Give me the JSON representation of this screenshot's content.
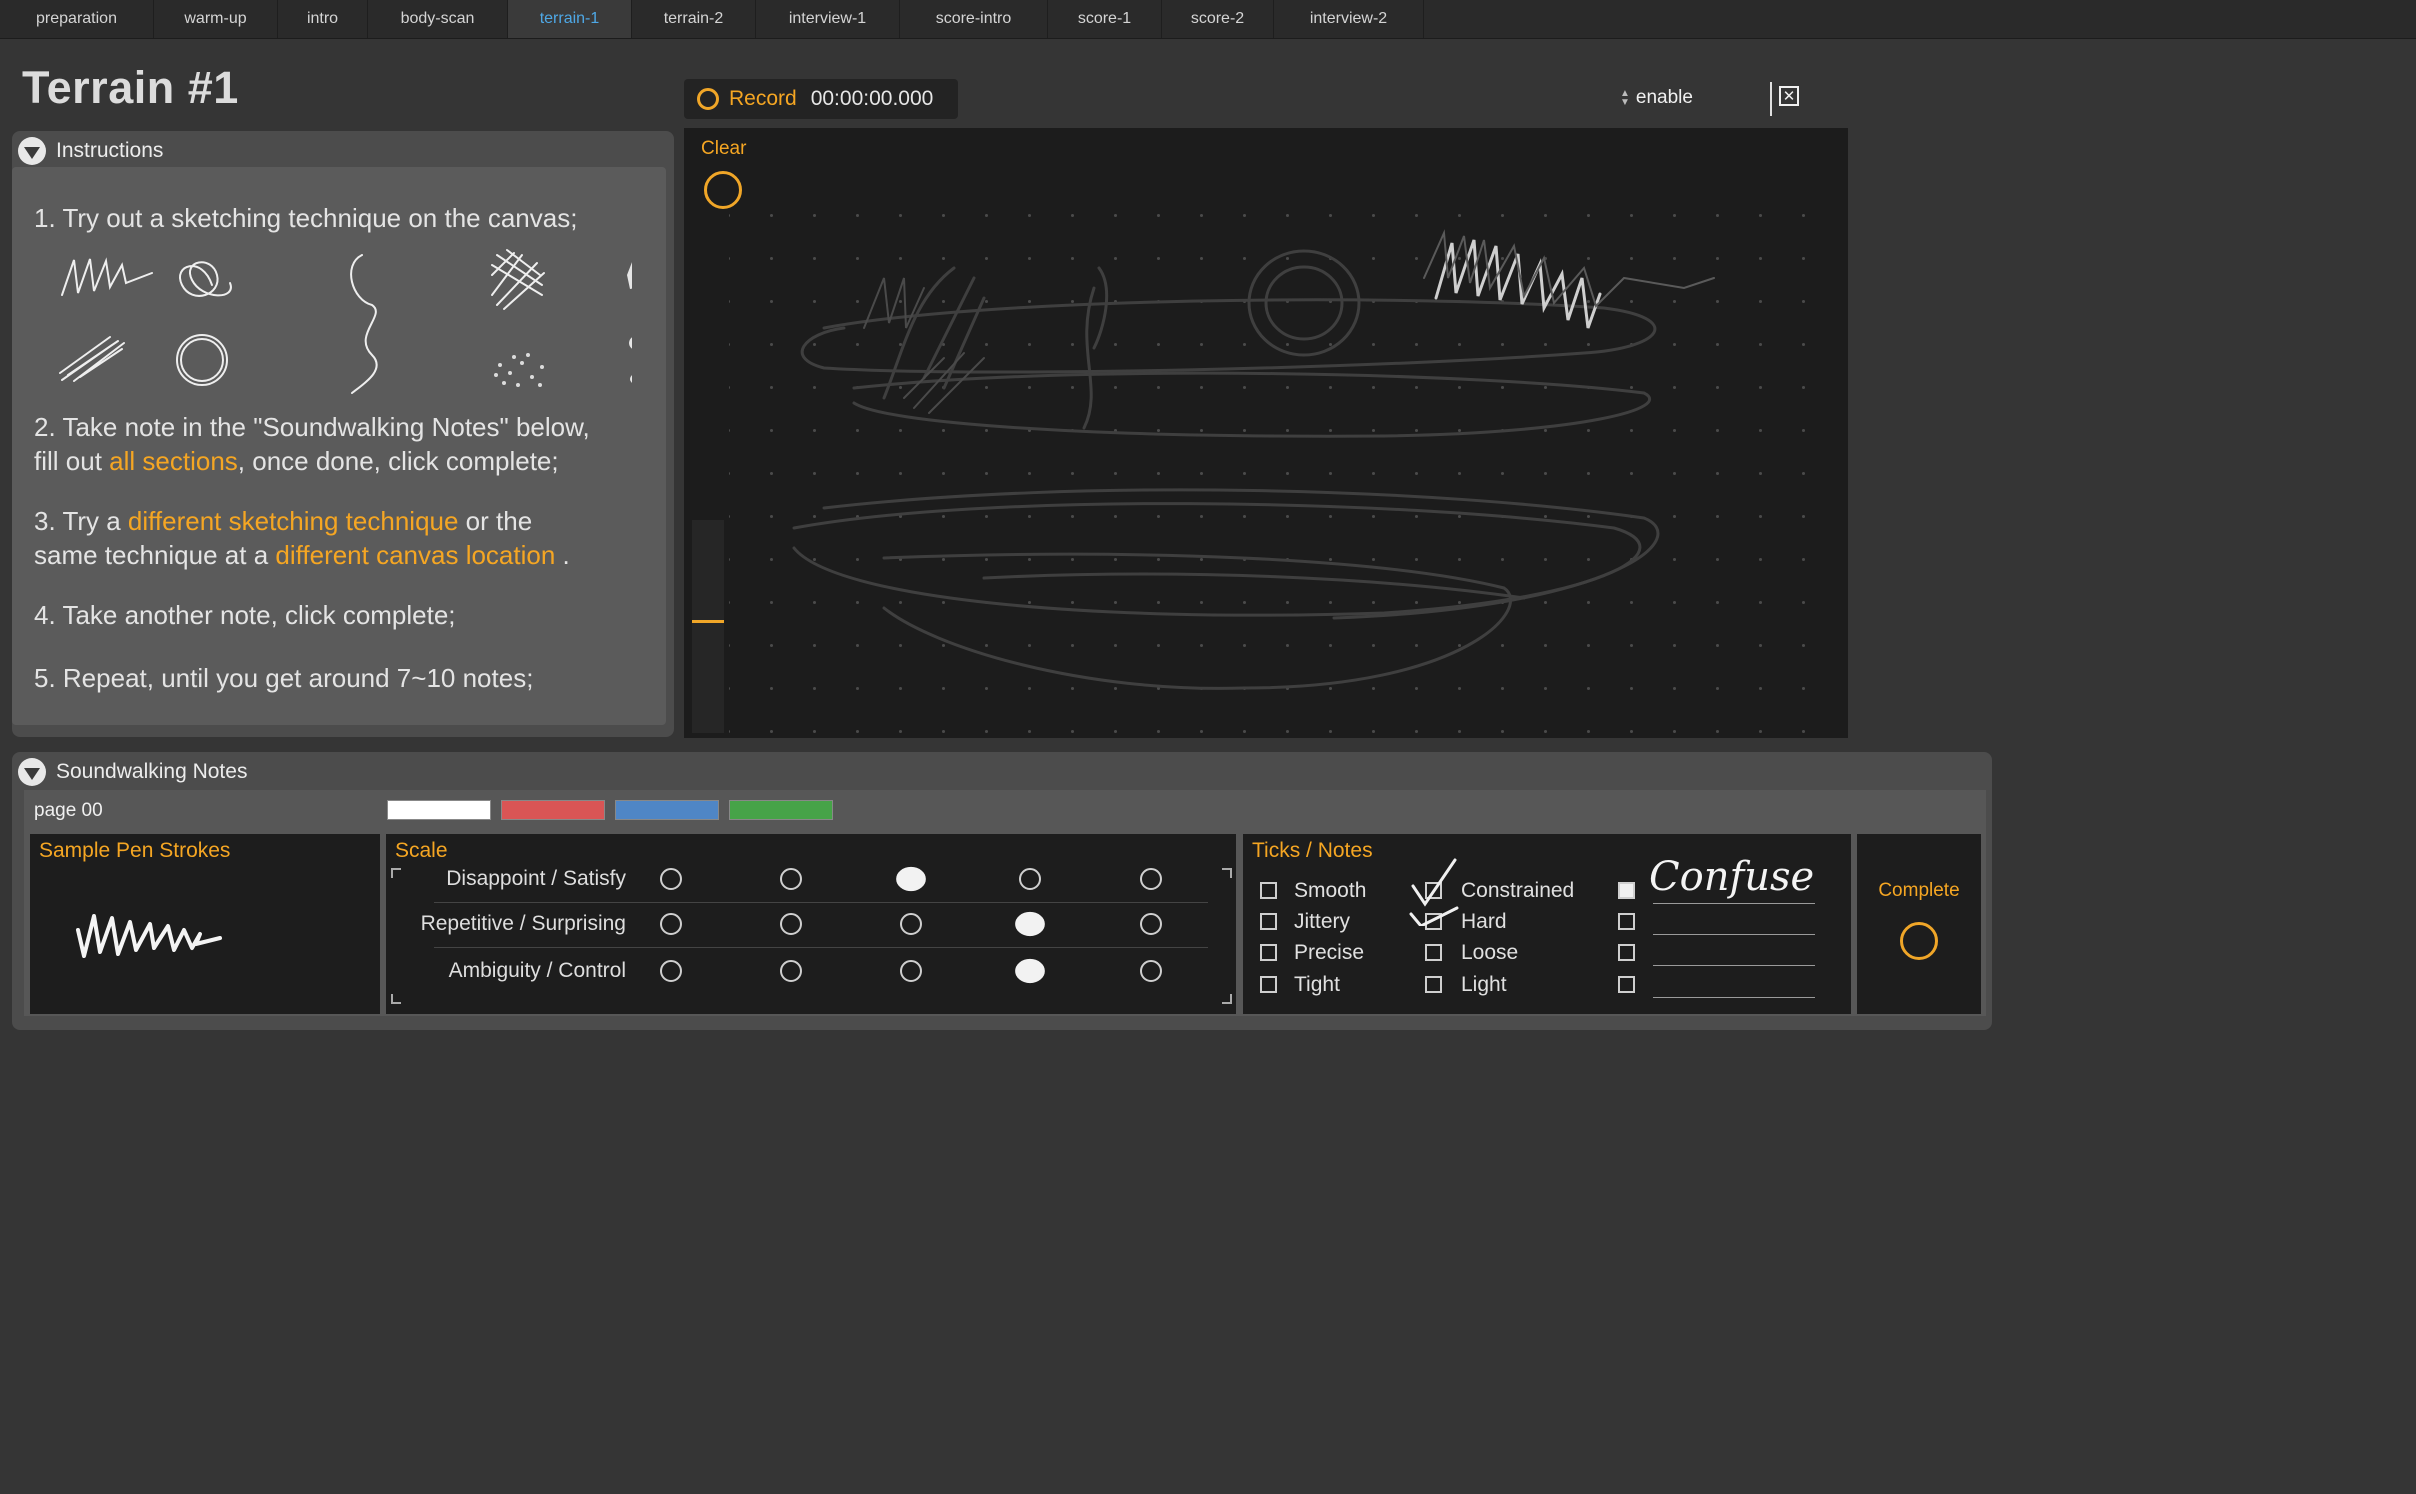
{
  "tabs": [
    "preparation",
    "warm-up",
    "intro",
    "body-scan",
    "terrain-1",
    "terrain-2",
    "interview-1",
    "score-intro",
    "score-1",
    "score-2",
    "interview-2"
  ],
  "active_tab": "terrain-1",
  "page_title": "Terrain #1",
  "instructions": {
    "header": "Instructions",
    "step1": "1. Try out a sketching technique on the canvas;",
    "step2_a": "2. Take note in the \"Soundwalking Notes\" below,",
    "step2_b": "fill out ",
    "step2_hl": "all sections",
    "step2_c": ", once done, click complete;",
    "step3_a": "3. Try a ",
    "step3_hl1": "different sketching technique",
    "step3_b": " or the",
    "step3_c": "same technique at a ",
    "step3_hl2": "different canvas location",
    "step3_d": " .",
    "step4": "4. Take another note, click complete;",
    "step5": "5. Repeat, until you get around 7~10 notes;"
  },
  "record": {
    "label": "Record",
    "time": "00:00:00.000"
  },
  "enable_label": "enable",
  "clear_label": "Clear",
  "notes": {
    "header": "Soundwalking Notes",
    "page": "page 00",
    "swatches": [
      "#ffffff",
      "#d95555",
      "#4f86c6",
      "#46a348"
    ],
    "sample_title": "Sample Pen Strokes",
    "scale_title": "Scale",
    "scale_rows": [
      "Disappoint / Satisfy",
      "Repetitive / Surprising",
      "Ambiguity / Control"
    ],
    "scale_selected": [
      2,
      3,
      3
    ],
    "ticks_title": "Ticks / Notes",
    "ticks_col1": [
      "Smooth",
      "Jittery",
      "Precise",
      "Tight"
    ],
    "ticks_col2": [
      "Constrained",
      "Hard",
      "Loose",
      "Light"
    ],
    "ticks_checked_col2": [
      "Constrained",
      "Hard"
    ],
    "note_text": "Confuse",
    "complete_label": "Complete"
  }
}
